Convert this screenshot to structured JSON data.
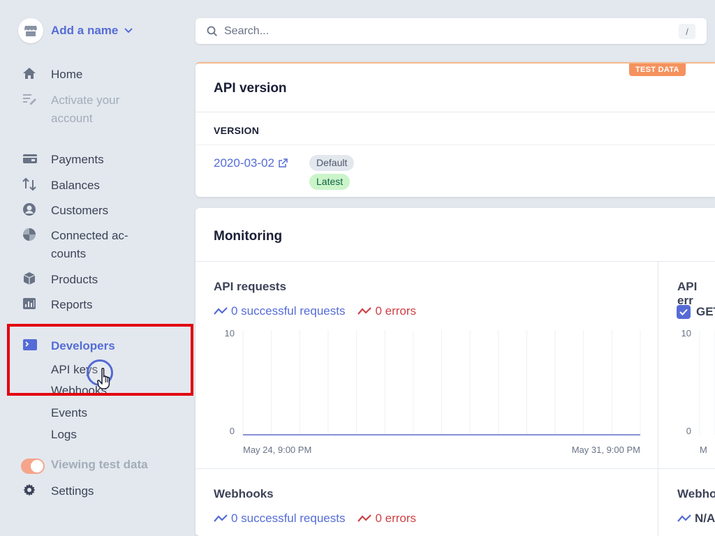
{
  "account": {
    "name": "Add a name"
  },
  "search": {
    "placeholder": "Search...",
    "shortcut": "/"
  },
  "sidebar": {
    "home": "Home",
    "activate": "Activate your account",
    "activate_line1": "Activate your",
    "activate_line2": "account",
    "payments": "Payments",
    "balances": "Balances",
    "customers": "Customers",
    "connected_line1": "Connected ac-",
    "connected_line2": "counts",
    "products": "Products",
    "reports": "Reports",
    "developers": "Developers",
    "developers_sub": [
      "API keys",
      "Webhooks",
      "Events",
      "Logs"
    ],
    "viewing_test_data": "Viewing test data",
    "settings": "Settings"
  },
  "api_version_card": {
    "badge": "TEST DATA",
    "title": "API version",
    "column_header": "VERSION",
    "version": "2020-03-02",
    "tags": [
      "Default",
      "Latest"
    ]
  },
  "monitoring_card": {
    "title": "Monitoring",
    "api_requests": {
      "title": "API requests",
      "legend_success": "0 successful requests",
      "legend_errors": "0 errors",
      "y_max": "10",
      "y_min": "0",
      "x_start": "May 24, 9:00 PM",
      "x_end": "May 31, 9:00 PM"
    },
    "api_errors": {
      "title": "API err",
      "filter": "GET",
      "y_max": "10",
      "y_min": "0",
      "x_start": "M"
    },
    "webhooks": {
      "title": "Webhooks",
      "legend_success": "0 successful requests",
      "legend_errors": "0 errors"
    },
    "webhooks_right": {
      "title": "Webho",
      "legend": "N/A"
    }
  },
  "colors": {
    "accent": "#556cd6",
    "error": "#cd4246",
    "test_badge": "#f5925e",
    "highlight": "#e3000f"
  }
}
